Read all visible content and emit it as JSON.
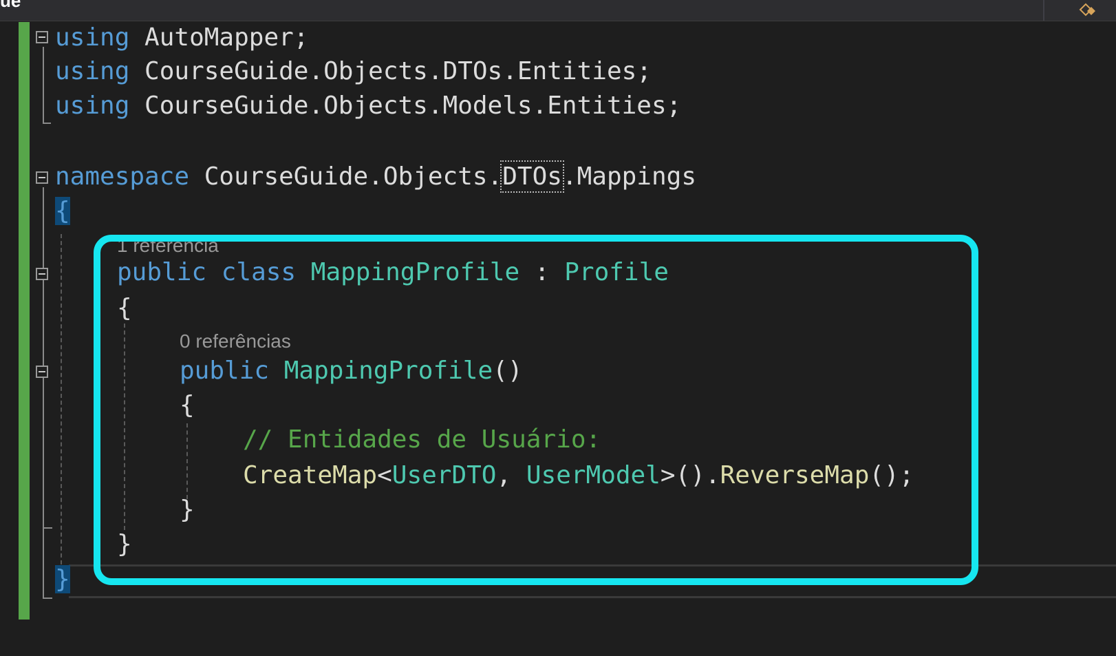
{
  "toolbar": {
    "tab_fragment": "ue",
    "right_icon": "class-symbol-icon"
  },
  "editor": {
    "lines": {
      "l1": {
        "kw": "using",
        "rest": " AutoMapper;"
      },
      "l2": {
        "kw": "using",
        "rest": " CourseGuide.Objects.DTOs.Entities;"
      },
      "l3": {
        "kw": "using",
        "rest": " CourseGuide.Objects.Models.Entities;"
      },
      "l4": {
        "kw": "namespace",
        "pre": " CourseGuide.Objects.",
        "hl": "DTOs",
        "post": ".Mappings"
      },
      "l5": {
        "brace": "{"
      },
      "l6": {
        "kw1": "public",
        "kw2": " class ",
        "type": "MappingProfile",
        "sep": " : ",
        "base": "Profile"
      },
      "l7": {
        "brace": "{"
      },
      "l8": {
        "kw": "public ",
        "fn": "MappingProfile",
        "parens": "()"
      },
      "l9": {
        "brace": "{"
      },
      "l10": {
        "comment": "// Entidades de Usuário:"
      },
      "l11": {
        "fn": "CreateMap",
        "lt": "<",
        "t1": "UserDTO",
        "comma": ", ",
        "t2": "UserModel",
        "tail": ">().",
        "fn2": "ReverseMap",
        "end": "();"
      },
      "l12": {
        "brace": "}"
      },
      "l13": {
        "brace": "}"
      },
      "l14": {
        "brace": "}"
      }
    },
    "codelens": {
      "class_refs": "1 referência",
      "ctor_refs": "0 referências"
    }
  },
  "colors": {
    "keyword": "#569cd6",
    "type": "#4ec9b0",
    "method": "#dcdcaa",
    "comment": "#57a64a",
    "highlight_box": "#16e6f0"
  }
}
